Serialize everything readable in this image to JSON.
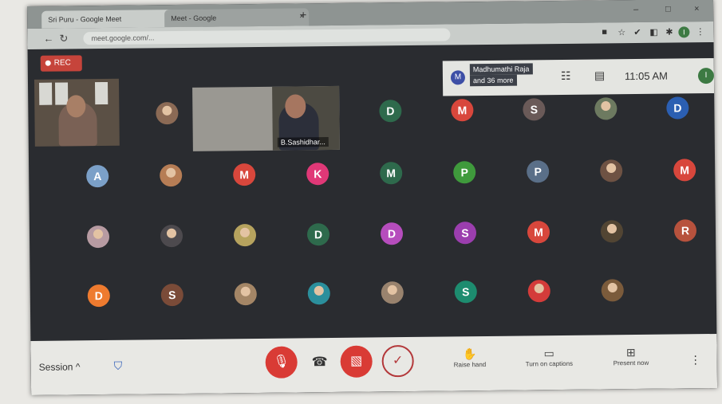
{
  "browser": {
    "tabs": [
      {
        "title": "Sri Puru - Google Meet"
      },
      {
        "title": "Meet - Google"
      }
    ],
    "url": "meet.google.com/..."
  },
  "recording_label": "REC",
  "participants_summary": {
    "avatar": "M",
    "name": "Madhumathi Raja",
    "more": "and 36 more"
  },
  "clock": "11:05 AM",
  "user_avatar": "I",
  "speaker_label": "B.Sashidhar...",
  "tiles": [
    {
      "t": "photo",
      "c": "#8b6a55"
    },
    {
      "t": "D",
      "c": "#2e6a4c"
    },
    {
      "t": "M",
      "c": "#d8473c"
    },
    {
      "t": "S",
      "c": "#6a5a58"
    },
    {
      "t": "photo",
      "c": "#6d7a60"
    },
    {
      "t": "D",
      "c": "#2b5fb2"
    },
    {
      "t": "A",
      "c": "#7ba0c8"
    },
    {
      "t": "photo",
      "c": "#b67d55"
    },
    {
      "t": "M",
      "c": "#d8473c"
    },
    {
      "t": "K",
      "c": "#e03877"
    },
    {
      "t": "M",
      "c": "#2e6a4c"
    },
    {
      "t": "P",
      "c": "#3f9a3c"
    },
    {
      "t": "P",
      "c": "#5a6f88"
    },
    {
      "t": "photo",
      "c": "#6e5243"
    },
    {
      "t": "M",
      "c": "#d8473c"
    },
    {
      "t": "photo",
      "c": "#b79ba2"
    },
    {
      "t": "photo",
      "c": "#4d4a4e"
    },
    {
      "t": "photo",
      "c": "#b6a35e"
    },
    {
      "t": "D",
      "c": "#2e6a4c"
    },
    {
      "t": "D",
      "c": "#b64dbd"
    },
    {
      "t": "S",
      "c": "#9b3eae"
    },
    {
      "t": "M",
      "c": "#d8473c"
    },
    {
      "t": "photo",
      "c": "#524533"
    },
    {
      "t": "R",
      "c": "#b7523d"
    },
    {
      "t": "D",
      "c": "#ee7b2f"
    },
    {
      "t": "S",
      "c": "#7a4b38"
    },
    {
      "t": "photo",
      "c": "#a48666"
    },
    {
      "t": "photo",
      "c": "#2b8f9c"
    },
    {
      "t": "photo",
      "c": "#99836e"
    },
    {
      "t": "S",
      "c": "#1d8c6f"
    },
    {
      "t": "photo",
      "c": "#d43c3a"
    },
    {
      "t": "photo",
      "c": "#7b5b3b"
    }
  ],
  "controls": {
    "session_label": "Session",
    "session_chevron": "^",
    "raise_hand": "Raise hand",
    "captions": "Turn on captions",
    "present": "Present now"
  },
  "colors": {
    "mic_off": "#d93b35",
    "cam_off": "#d93b35",
    "accent": "#2e5db8"
  }
}
